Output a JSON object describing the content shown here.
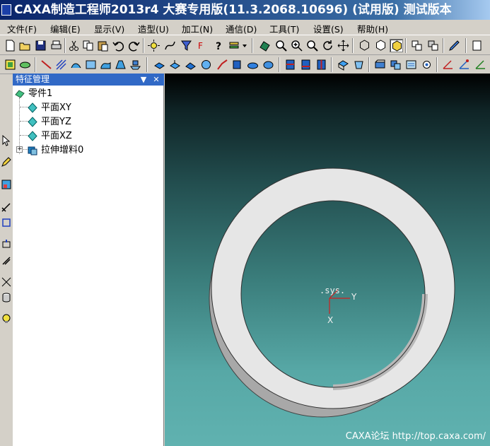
{
  "window": {
    "title": "CAXA制造工程师2013r4 大赛专用版(11.3.2068.10696) (试用版) 测试版本"
  },
  "menu": {
    "items": [
      {
        "label": "文件(F)"
      },
      {
        "label": "编辑(E)"
      },
      {
        "label": "显示(V)"
      },
      {
        "label": "造型(U)"
      },
      {
        "label": "加工(N)"
      },
      {
        "label": "通信(D)"
      },
      {
        "label": "工具(T)"
      },
      {
        "label": "设置(S)"
      },
      {
        "label": "帮助(H)"
      }
    ]
  },
  "toolbar1": {
    "icons": [
      "new-file-icon",
      "open-folder-icon",
      "save-icon",
      "print-icon",
      "cut-icon",
      "copy-icon",
      "paste-icon",
      "undo-icon",
      "redo-icon",
      "light-icon",
      "curve-icon",
      "filter-icon",
      "query-icon",
      "help-icon",
      "layer-icon",
      "dropdown-arrow-icon",
      "view-orient-icon",
      "zoom-window-icon",
      "zoom-in-icon",
      "zoom-dynamic-icon",
      "rotate-icon",
      "pan-icon",
      "wireframe-icon",
      "hidden-line-icon",
      "shaded-icon",
      "display-mode-icon",
      "display-mode2-icon",
      "pen-icon",
      "view-extra-icon"
    ]
  },
  "toolbar2": {
    "icons": [
      "sketch-icon",
      "feature-icon",
      "line-icon",
      "hatch-icon",
      "surface-icon",
      "surface2-icon",
      "surface3-icon",
      "surface4-icon",
      "surface5-icon",
      "extrude-icon",
      "revolve-icon",
      "sweep-icon",
      "loft-icon",
      "fillet-icon",
      "chamfer-icon",
      "shell-icon",
      "draft-icon",
      "hole-icon",
      "rib-icon",
      "pattern-icon",
      "mirror-icon",
      "scale-icon",
      "cut-icon2",
      "union-icon",
      "sculpt-icon",
      "mold-icon",
      "split-icon",
      "tool-icon",
      "tool2-icon",
      "tool3-icon",
      "measure-icon",
      "measure2-icon",
      "measure3-icon"
    ]
  },
  "panel": {
    "title": "特征管理",
    "dropdown_glyph": "▼",
    "close_glyph": "✕"
  },
  "tree": {
    "root": "零件1",
    "children": [
      {
        "label": "平面XY"
      },
      {
        "label": "平面YZ"
      },
      {
        "label": "平面XZ"
      },
      {
        "label": "拉伸增料0"
      }
    ],
    "expander_glyph": "+"
  },
  "viewport": {
    "axis_label": ".sys.",
    "axis_y": "Y",
    "axis_x": "X",
    "watermark": "CAXA论坛 http://top.caxa.com/"
  },
  "colors": {
    "panel_header": "#3169c6",
    "ring_face": "#e6e6e6",
    "ring_side": "#a8a8a8",
    "axis_red": "#d02020"
  }
}
